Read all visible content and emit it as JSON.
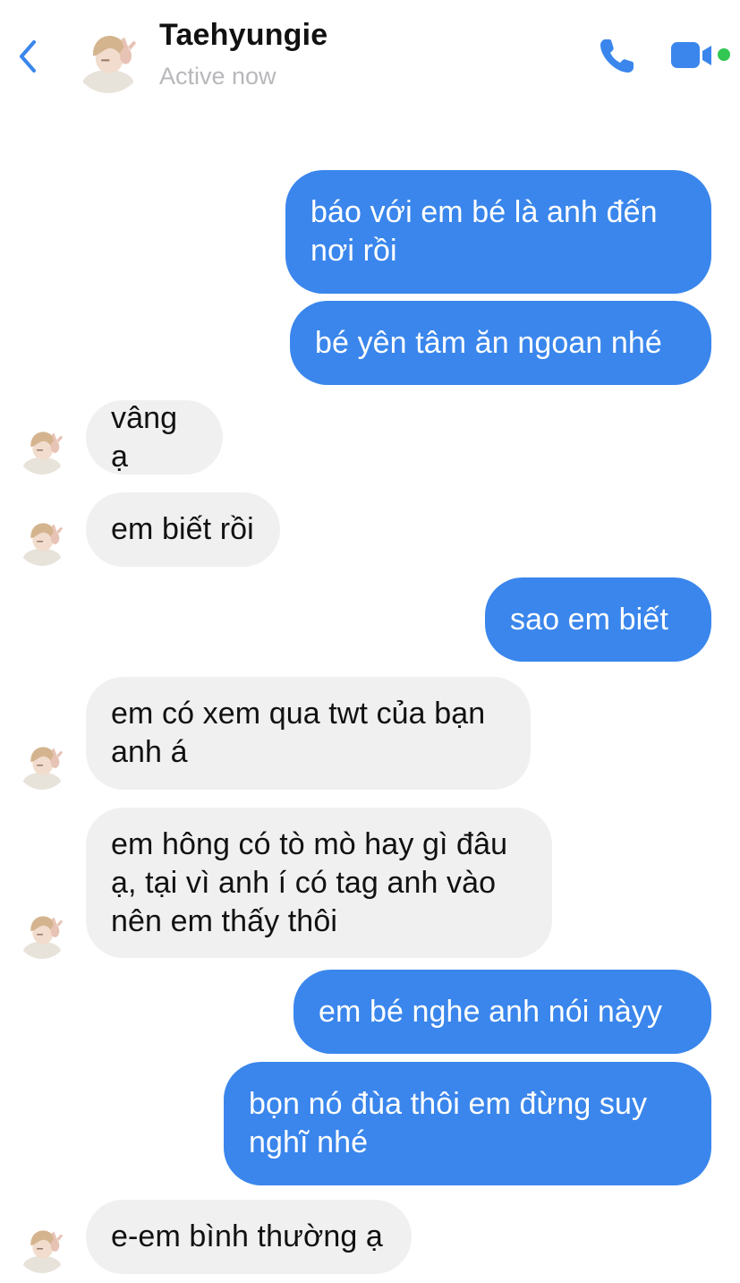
{
  "header": {
    "back_icon": "chevron-left-icon",
    "contact_name": "Taehyungie",
    "status": "Active now",
    "call_icon": "phone-icon",
    "video_icon": "video-camera-icon",
    "online_indicator_color": "#31c752"
  },
  "colors": {
    "accent": "#3a86ec",
    "outgoing_bubble": "#3a86ec",
    "incoming_bubble": "#f0f0f0"
  },
  "messages": [
    {
      "direction": "out",
      "text": "báo với em bé là anh đến nơi rồi"
    },
    {
      "direction": "out",
      "text": "bé yên tâm ăn ngoan nhé"
    },
    {
      "direction": "in",
      "text": "vâng ạ"
    },
    {
      "direction": "in",
      "text": "em biết rồi"
    },
    {
      "direction": "out",
      "text": "sao em biết"
    },
    {
      "direction": "in",
      "text": "em có xem qua twt của bạn anh á"
    },
    {
      "direction": "in",
      "text": "em hông có tò mò hay gì đâu ạ, tại vì anh í có tag anh vào nên em thấy thôi"
    },
    {
      "direction": "out",
      "text": "em bé nghe anh nói nàyy"
    },
    {
      "direction": "out",
      "text": "bọn nó đùa thôi em đừng suy nghĩ nhé"
    },
    {
      "direction": "in",
      "text": "e-em bình thường ạ"
    }
  ]
}
